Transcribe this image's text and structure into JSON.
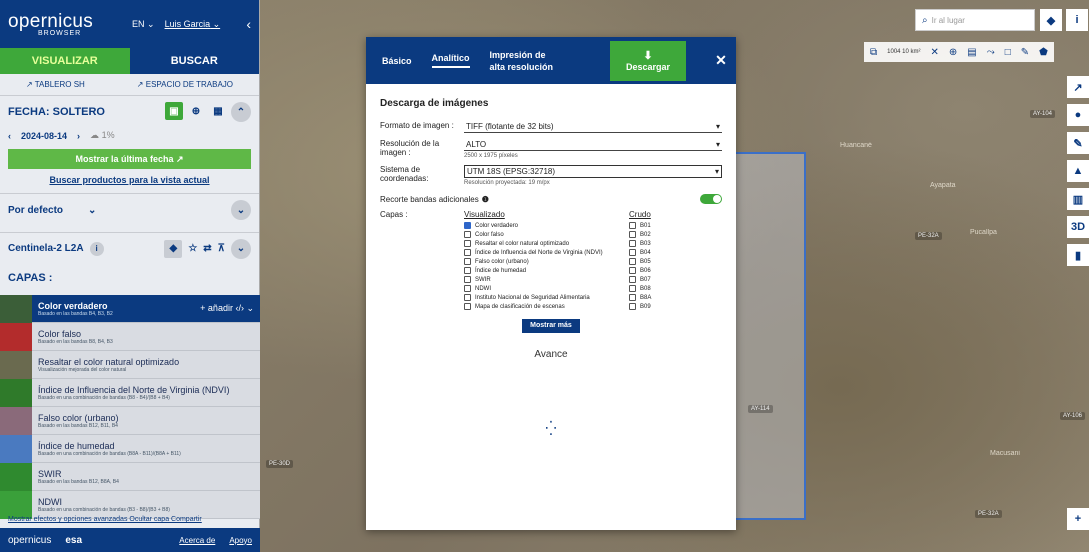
{
  "header": {
    "logo_main": "opernicus",
    "logo_sub": "BROWSER",
    "lang": "EN",
    "user": "Luis Garcia"
  },
  "tabs": [
    "VISUALIZAR",
    "BUSCAR"
  ],
  "sublinks": {
    "left": "TABLERO SH",
    "right": "ESPACIO DE TRABAJO"
  },
  "date_section": {
    "title": "FECHA: SOLTERO",
    "date": "2024-08-14",
    "cloud": "1%",
    "show_latest": "Mostrar la última fecha",
    "search_link": "Buscar productos para la vista actual"
  },
  "sort": {
    "label": "Por defecto"
  },
  "collection": {
    "label": "Centinela-2 L2A"
  },
  "layers_title": "CAPAS :",
  "layers": [
    {
      "name": "Color verdadero",
      "desc": "Basado en las bandas B4, B3, B2",
      "add": "+ añadir",
      "color": "#3b5e38"
    },
    {
      "name": "Color falso",
      "desc": "Basado en las bandas B8, B4, B3",
      "color": "#b32c2c"
    },
    {
      "name": "Resaltar el color natural optimizado",
      "desc": "Visualización mejorada del color natural",
      "color": "#6a6a4f"
    },
    {
      "name": "Índice de Influencia del Norte de Virginia (NDVI)",
      "desc": "Basado en una combinación de bandas (B8 - B4)/(B8 + B4)",
      "color": "#2f7a2a"
    },
    {
      "name": "Falso color (urbano)",
      "desc": "Basado en las bandas B12, B11, B4",
      "color": "#8a6a7a"
    },
    {
      "name": "Índice de humedad",
      "desc": "Basado en una combinación de bandas (B8A - B11)/(B8A + B11)",
      "color": "#4a7ac0"
    },
    {
      "name": "SWIR",
      "desc": "Basado en las bandas B12, B8A, B4",
      "color": "#2f8a2f"
    },
    {
      "name": "NDWI",
      "desc": "Basado en una combinación de bandas (B3 - B8)/(B3 + B8)",
      "color": "#3aa03a"
    }
  ],
  "bottom_links": "Mostrar efectos y opciones avanzadas  Ocultar capa  Compartir",
  "footer": {
    "brand1": "opernicus",
    "brand2": "esa",
    "link1": "Acerca de",
    "link2": "Apoyo"
  },
  "dialog": {
    "tabs": [
      "Básico",
      "Analítico",
      "Impresión de alta resolución"
    ],
    "download": "Descargar",
    "title": "Descarga de imágenes",
    "format_label": "Formato de imagen :",
    "format_value": "TIFF (flotante de 32 bits)",
    "res_label": "Resolución de la imagen :",
    "res_value": "ALTO",
    "res_sub": "2500 x 1975 píxeles",
    "crs_label": "Sistema de coordenadas:",
    "crs_value": "UTM 18S (EPSG:32718)",
    "crs_sub": "Resolución proyectada: 19 m/px",
    "clip_label": "Recorte bandas adicionales",
    "layers_label": "Capas :",
    "vis_head": "Visualizado",
    "raw_head": "Crudo",
    "vis_items": [
      "Color verdadero",
      "Color falso",
      "Resaltar el color natural optimizado",
      "Índice de Influencia del Norte de Virginia (NDVI)",
      "Falso color (urbano)",
      "Índice de humedad",
      "SWIR",
      "NDWI",
      "Instituto Nacional de Seguridad Alimentaria",
      "Mapa de clasificación de escenas"
    ],
    "raw_items": [
      "B01",
      "B02",
      "B03",
      "B04",
      "B05",
      "B06",
      "B07",
      "B08",
      "B8A",
      "B09"
    ],
    "more": "Mostrar más",
    "progress": "Avance"
  },
  "map": {
    "search_placeholder": "Ir al lugar",
    "area": "1004 10 km²"
  }
}
